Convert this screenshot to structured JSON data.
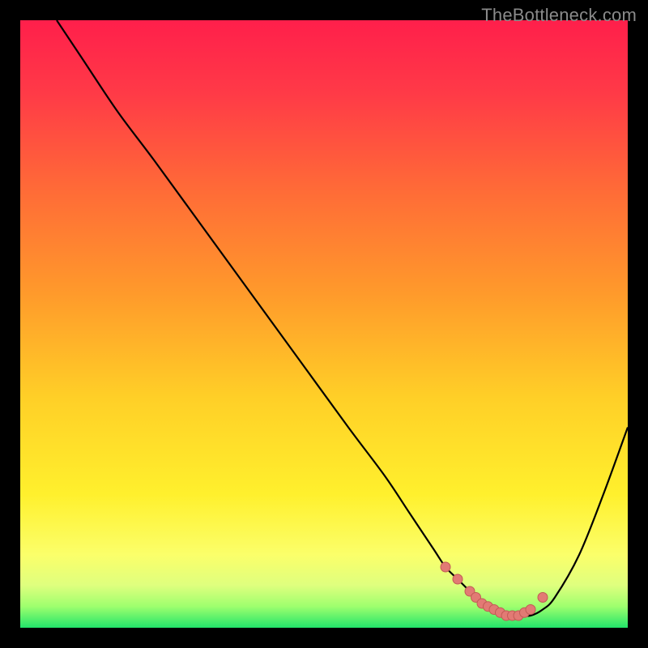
{
  "watermark": "TheBottleneck.com",
  "colors": {
    "bg": "#000000",
    "watermark": "#8a8a8a",
    "gradient_stops": [
      {
        "offset": 0.0,
        "color": "#ff1f4b"
      },
      {
        "offset": 0.12,
        "color": "#ff3a47"
      },
      {
        "offset": 0.28,
        "color": "#ff6b37"
      },
      {
        "offset": 0.45,
        "color": "#ff9a2b"
      },
      {
        "offset": 0.62,
        "color": "#ffcf27"
      },
      {
        "offset": 0.78,
        "color": "#fff02d"
      },
      {
        "offset": 0.88,
        "color": "#fbff6a"
      },
      {
        "offset": 0.93,
        "color": "#dfff7e"
      },
      {
        "offset": 0.965,
        "color": "#9eff6e"
      },
      {
        "offset": 1.0,
        "color": "#22e46a"
      }
    ],
    "curve": "#000000",
    "marker_fill": "#e27a74",
    "marker_stroke": "#c25b55"
  },
  "chart_data": {
    "type": "line",
    "title": "",
    "xlabel": "",
    "ylabel": "",
    "xlim": [
      0,
      100
    ],
    "ylim": [
      0,
      100
    ],
    "series": [
      {
        "name": "bottleneck-curve",
        "x": [
          6,
          10,
          16,
          22,
          30,
          38,
          46,
          54,
          60,
          64,
          68,
          70,
          72,
          74,
          76,
          78,
          80,
          82,
          84,
          86,
          88,
          92,
          96,
          100
        ],
        "y": [
          100,
          94,
          85,
          77,
          66,
          55,
          44,
          33,
          25,
          19,
          13,
          10,
          8,
          6,
          4,
          3,
          2,
          2,
          2,
          3,
          5,
          12,
          22,
          33
        ]
      }
    ],
    "markers": {
      "name": "valley-markers",
      "x": [
        70,
        72,
        74,
        75,
        76,
        77,
        78,
        79,
        80,
        81,
        82,
        83,
        84,
        86
      ],
      "y": [
        10,
        8,
        6,
        5,
        4,
        3.5,
        3,
        2.5,
        2,
        2,
        2,
        2.5,
        3,
        5
      ]
    }
  }
}
